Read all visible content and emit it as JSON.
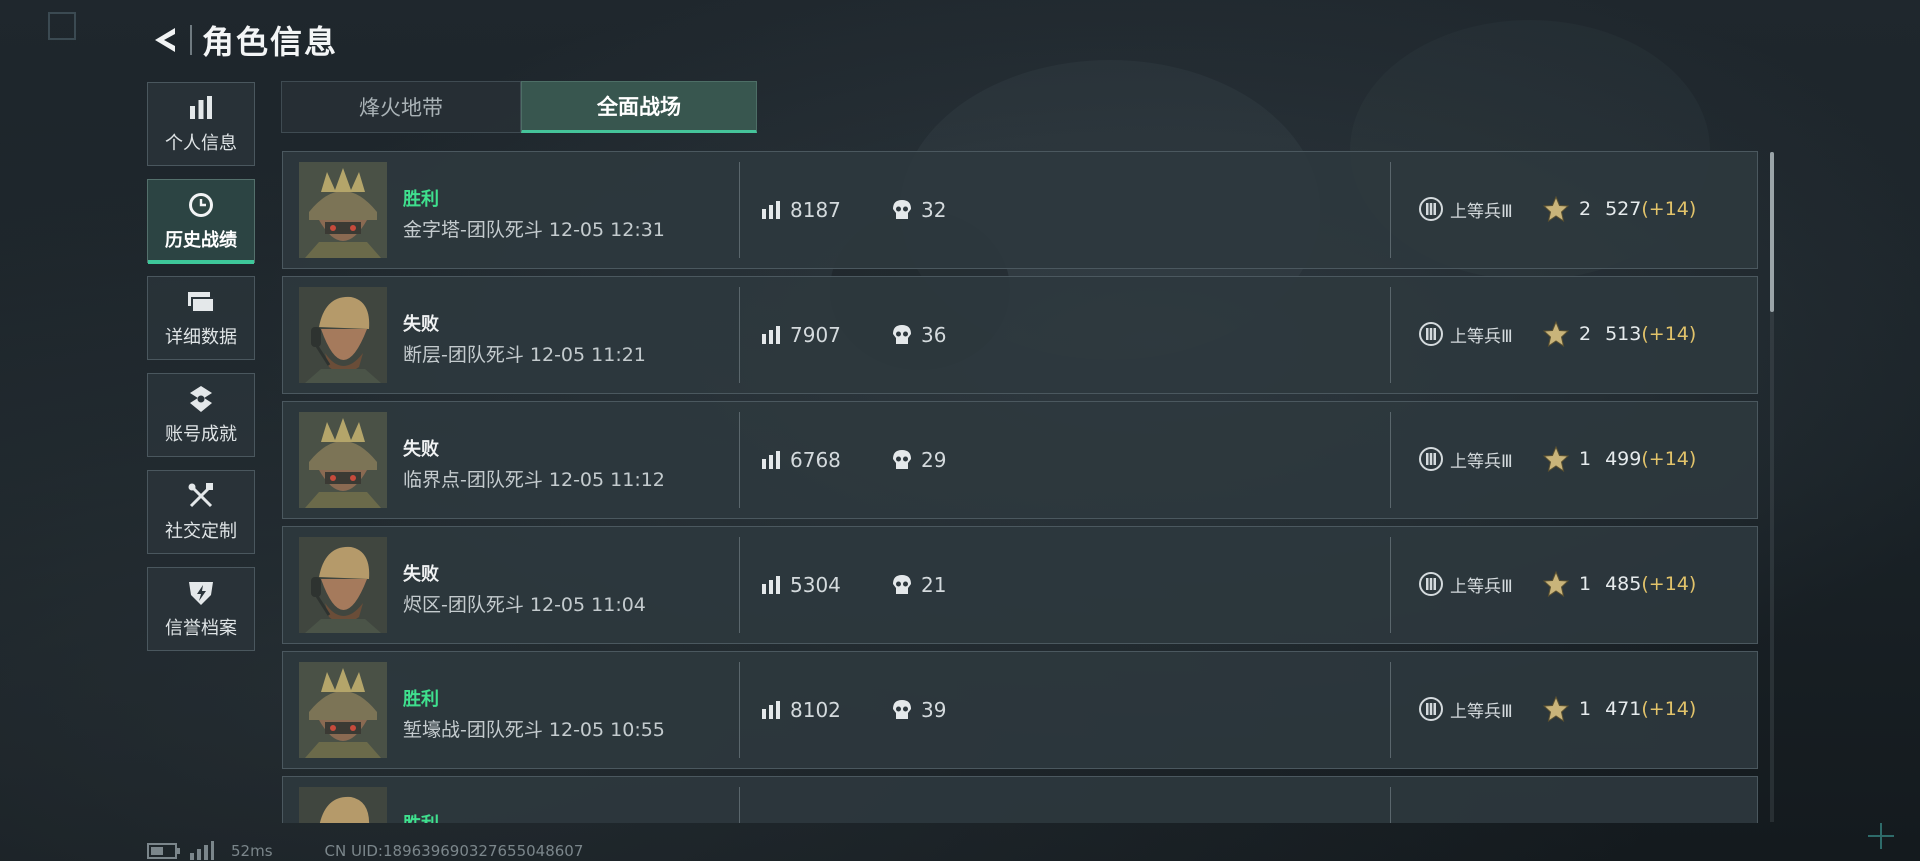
{
  "header": {
    "title": "角色信息"
  },
  "sidebar": {
    "items": [
      {
        "label": "个人信息",
        "icon": "bar-chart-icon",
        "active": false
      },
      {
        "label": "历史战绩",
        "icon": "clock-icon",
        "active": true
      },
      {
        "label": "详细数据",
        "icon": "cards-icon",
        "active": false
      },
      {
        "label": "账号成就",
        "icon": "medal-icon",
        "active": false
      },
      {
        "label": "社交定制",
        "icon": "tools-icon",
        "active": false
      },
      {
        "label": "信誉档案",
        "icon": "shield-icon",
        "active": false
      }
    ]
  },
  "tabs": [
    {
      "label": "烽火地带",
      "active": false
    },
    {
      "label": "全面战场",
      "active": true
    }
  ],
  "matches": [
    {
      "result": "胜利",
      "match": "金字塔-团队死斗 12-05 12:31",
      "score": "8187",
      "kills": "32",
      "rank": "上等兵Ⅲ",
      "stars": "2",
      "points": "527",
      "delta": "(+14)",
      "avatar": "helmet-soldier"
    },
    {
      "result": "失败",
      "match": "断层-团队死斗 12-05 11:21",
      "score": "7907",
      "kills": "36",
      "rank": "上等兵Ⅲ",
      "stars": "2",
      "points": "513",
      "delta": "(+14)",
      "avatar": "headset-soldier"
    },
    {
      "result": "失败",
      "match": "临界点-团队死斗 12-05 11:12",
      "score": "6768",
      "kills": "29",
      "rank": "上等兵Ⅲ",
      "stars": "1",
      "points": "499",
      "delta": "(+14)",
      "avatar": "helmet-soldier"
    },
    {
      "result": "失败",
      "match": "烬区-团队死斗 12-05 11:04",
      "score": "5304",
      "kills": "21",
      "rank": "上等兵Ⅲ",
      "stars": "1",
      "points": "485",
      "delta": "(+14)",
      "avatar": "headset-soldier"
    },
    {
      "result": "胜利",
      "match": "堑壕战-团队死斗 12-05 10:55",
      "score": "8102",
      "kills": "39",
      "rank": "上等兵Ⅲ",
      "stars": "1",
      "points": "471",
      "delta": "(+14)",
      "avatar": "helmet-soldier"
    },
    {
      "result": "胜利",
      "match": "",
      "score": "",
      "kills": "",
      "rank": "",
      "stars": "",
      "points": "",
      "delta": "",
      "avatar": "headset-soldier"
    }
  ],
  "footer": {
    "ping": "52ms",
    "uid": "CN UID:189639690327655048607"
  },
  "colors": {
    "accent": "#3ec79a",
    "win": "#3fe08e",
    "delta": "#e2c36a"
  }
}
